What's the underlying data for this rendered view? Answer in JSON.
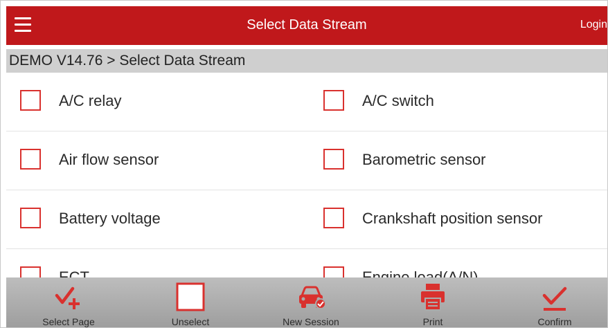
{
  "header": {
    "title": "Select Data Stream",
    "login_label": "Login",
    "menu_icon": "hamburger-icon"
  },
  "breadcrumb": "DEMO V14.76 > Select Data Stream",
  "rows": [
    {
      "left": "A/C relay",
      "right": "A/C switch"
    },
    {
      "left": "Air flow sensor",
      "right": "Barometric sensor"
    },
    {
      "left": "Battery voltage",
      "right": "Crankshaft position sensor"
    },
    {
      "left": "ECT",
      "right": "Engine load(A/N)"
    }
  ],
  "toolbar": {
    "select_page": "Select Page",
    "unselect": "Unselect",
    "new_session": "New Session",
    "print": "Print",
    "confirm": "Confirm"
  },
  "colors": {
    "header_bg": "#c0181b",
    "accent": "#d9312e",
    "breadcrumb_bg": "#cfcfcf",
    "toolbar_bg": "#ababab"
  }
}
